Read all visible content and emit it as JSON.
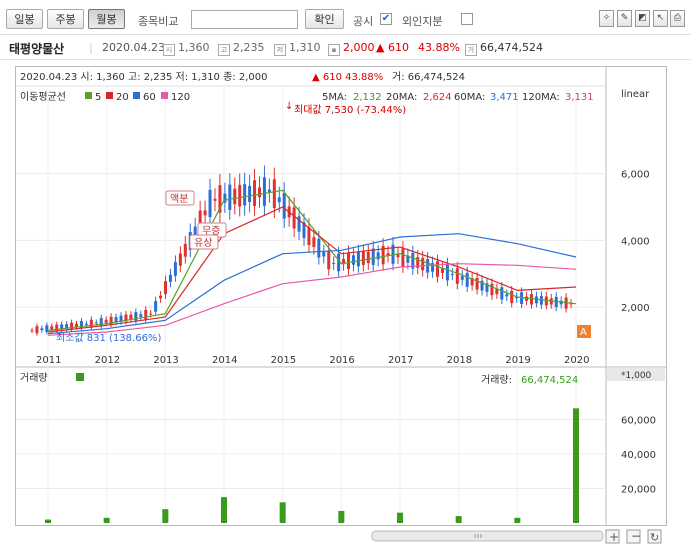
{
  "toolbar": {
    "daily_label": "일봉",
    "weekly_label": "주봉",
    "monthly_label": "월봉",
    "compare_label": "종목비교",
    "confirm_label": "확인",
    "disclosure_label": "공시",
    "disclosure_checked": "✔",
    "foreign_label": "외인지분"
  },
  "info": {
    "name": "태평양물산",
    "date": "2020.04.23",
    "open": "1,360",
    "high": "2,235",
    "low": "1,310",
    "close": "2,000",
    "change": "▲ 610",
    "change_pct": "43.88%",
    "volume": "66,474,524",
    "icon_open": "시",
    "icon_high": "고",
    "icon_low": "저",
    "icon_volume": "거"
  },
  "price_panel": {
    "header": "2020.04.23 시: 1,360 고: 2,235 저: 1,310 종: 2,000",
    "header_change": "▲  610  43.88%",
    "header_volume": "거: 66,474,524",
    "ma_title": "이동평균선",
    "ma_legend": [
      {
        "label": "5",
        "color": "#5aa02c"
      },
      {
        "label": "20",
        "color": "#d62728"
      },
      {
        "label": "60",
        "color": "#2a6fd6"
      },
      {
        "label": "120",
        "color": "#e85aa8"
      }
    ],
    "ma_values": [
      {
        "label": "5MA:",
        "value": "2,132",
        "color": "#3a9a1c"
      },
      {
        "label": "20MA:",
        "value": "2,624",
        "color": "#d62728"
      },
      {
        "label": "60MA:",
        "value": "3,471",
        "color": "#2a6fd6"
      },
      {
        "label": "120MA:",
        "value": "3,131",
        "color": "#d6388a"
      }
    ],
    "scale": "linear",
    "max_label": "최대값 7,530 (-73.44%)",
    "min_label": "최소값 831 (138.66%)",
    "event_right": "액분",
    "event_inc": "무증",
    "event_bonus": "유상",
    "current_tag": "A"
  },
  "volume_panel": {
    "title": "거래량",
    "value_label": "거래량:",
    "value": "66,474,524",
    "unit": "*1,000",
    "color": "#3a9a1c"
  },
  "chart_data": [
    {
      "type": "line",
      "title": "",
      "x": [
        "2011",
        "2012",
        "2013",
        "2014",
        "2015",
        "2016",
        "2017",
        "2018",
        "2019",
        "2020"
      ],
      "ylim": [
        500,
        8000
      ],
      "yticks": [
        2000,
        4000,
        6000
      ],
      "series": [
        {
          "name": "5",
          "color": "#5aa02c",
          "values": [
            1300,
            1500,
            1800,
            5200,
            5500,
            3300,
            3600,
            3000,
            2300,
            2100
          ]
        },
        {
          "name": "20",
          "color": "#d62728",
          "values": [
            1250,
            1450,
            1700,
            4200,
            5000,
            3600,
            3800,
            3200,
            2500,
            2600
          ]
        },
        {
          "name": "60",
          "color": "#2a6fd6",
          "values": [
            1200,
            1350,
            1600,
            2800,
            3600,
            3700,
            4100,
            4200,
            3900,
            3500
          ]
        },
        {
          "name": "120",
          "color": "#e85aa8",
          "values": [
            1150,
            1250,
            1450,
            2100,
            2700,
            2900,
            3200,
            3300,
            3250,
            3130
          ]
        }
      ]
    },
    {
      "type": "bar",
      "title": "",
      "x": [
        "2011",
        "2012",
        "2013",
        "2014",
        "2015",
        "2016",
        "2017",
        "2018",
        "2019",
        "2020"
      ],
      "ylim": [
        0,
        80000
      ],
      "yticks": [
        20000,
        40000,
        60000
      ],
      "values": [
        2000,
        3000,
        8000,
        15000,
        12000,
        7000,
        6000,
        4000,
        3000,
        66475
      ]
    }
  ]
}
